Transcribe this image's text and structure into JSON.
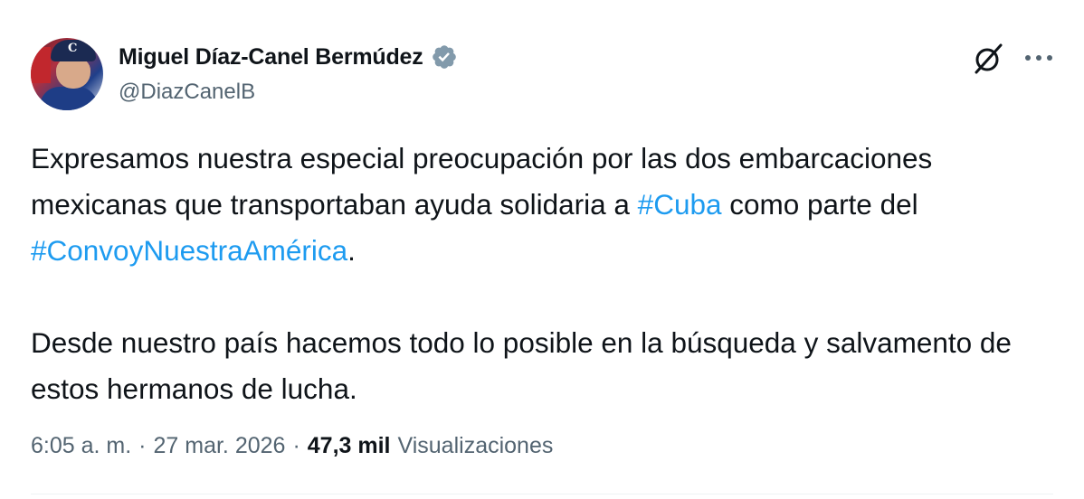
{
  "author": {
    "display_name": "Miguel Díaz-Canel Bermúdez",
    "handle": "@DiazCanelB",
    "verified": true,
    "avatar_icon": "profile-photo",
    "avatar_cap_letter": "C"
  },
  "post": {
    "p1": {
      "before": "Expresamos nuestra especial preocupación por las dos embarcaciones mexicanas que transportaban ayuda solidaria a ",
      "hashtag_1": "#Cuba",
      "middle": " como parte del ",
      "hashtag_2": "#ConvoyNuestraAmérica",
      "after": "."
    },
    "p2": "Desde nuestro país hacemos todo lo posible en la búsqueda y salvamento de estos hermanos de lucha."
  },
  "meta": {
    "time": "6:05 a. m.",
    "separator": "·",
    "date": "27 mar. 2026",
    "views_count": "47,3 mil",
    "views_label": "Visualizaciones"
  },
  "icons": {
    "grok": "grok-icon",
    "more": "more-icon",
    "verified": "verified-badge-icon"
  },
  "colors": {
    "text": "#0f1419",
    "secondary": "#536471",
    "link": "#1d9bf0",
    "badge": "#829aab"
  }
}
